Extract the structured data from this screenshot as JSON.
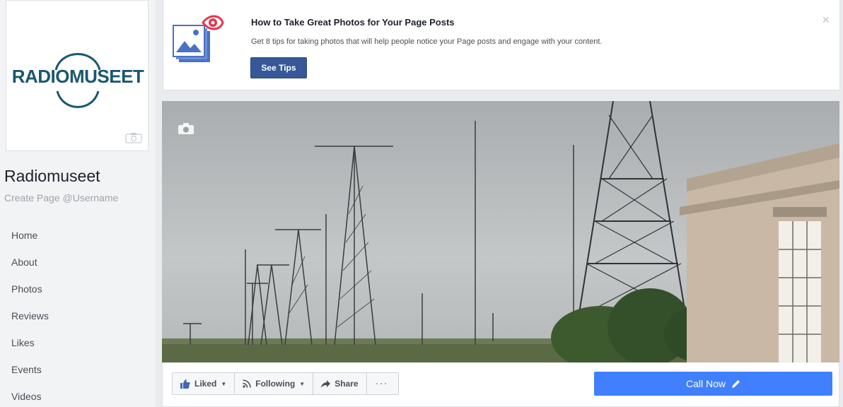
{
  "profile": {
    "logo_text": "RADIOMUSEET",
    "name": "Radiomuseet",
    "username_prompt": "Create Page @Username"
  },
  "nav": {
    "items": [
      {
        "label": "Home"
      },
      {
        "label": "About"
      },
      {
        "label": "Photos"
      },
      {
        "label": "Reviews"
      },
      {
        "label": "Likes"
      },
      {
        "label": "Events"
      },
      {
        "label": "Videos"
      }
    ]
  },
  "tips": {
    "title": "How to Take Great Photos for Your Page Posts",
    "description": "Get 8 tips for taking photos that will help people notice your Page posts and engage with your content.",
    "button_label": "See Tips",
    "close_glyph": "×",
    "icon": "photo-tips-icon"
  },
  "actions": {
    "liked_label": "Liked",
    "following_label": "Following",
    "share_label": "Share",
    "more_label": "···",
    "dropdown_caret": "▼",
    "call_label": "Call Now"
  },
  "colors": {
    "brand_blue": "#365899",
    "call_blue": "#4080ff",
    "logo_teal": "#1b5770",
    "page_bg": "#e9ebee"
  }
}
